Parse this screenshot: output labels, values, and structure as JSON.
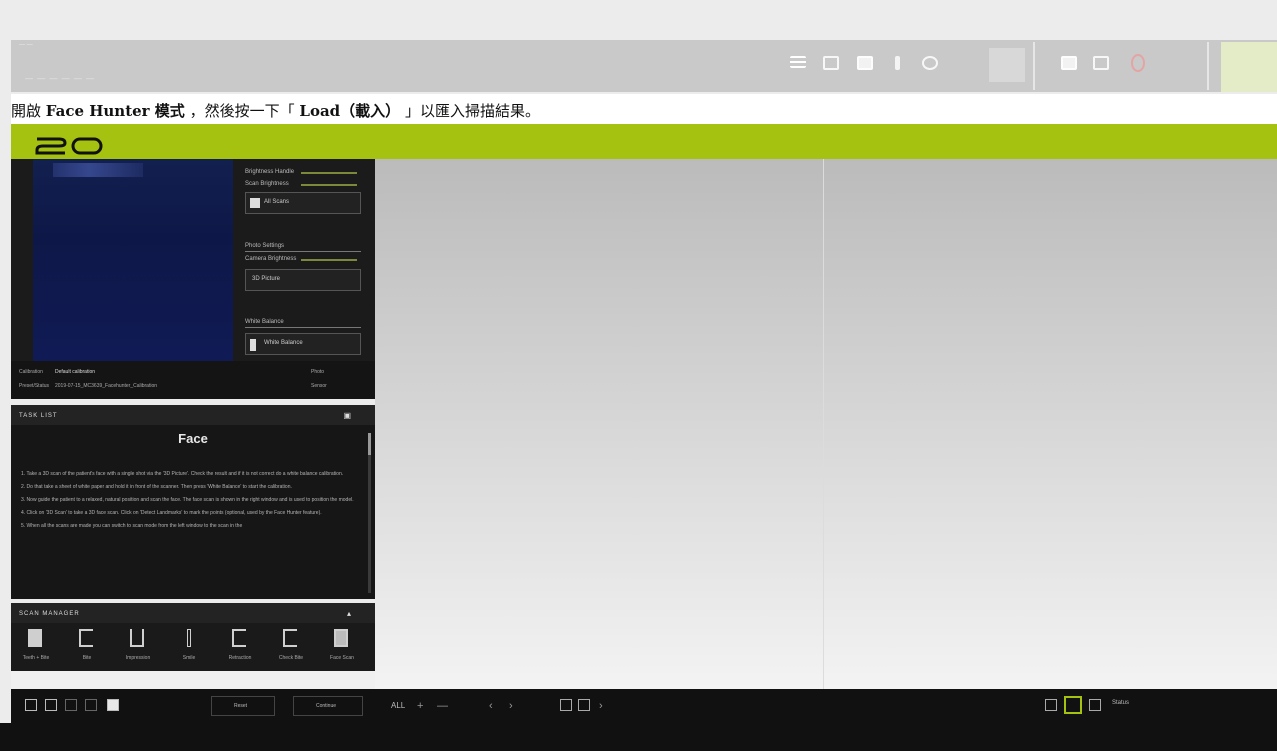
{
  "caption": {
    "prefix": "開啟 ",
    "mode_name": "Face Hunter 模式",
    "middle": "，然後按一下「",
    "button_name": "Load（載入）",
    "suffix": "」以匯入掃描結果。"
  },
  "window": {
    "tiny_label": "— —",
    "title_blur": "— — — — — —"
  },
  "settings": {
    "brightness_label": "Brightness Handle",
    "scan_brightness_label": "Scan Brightness",
    "all_scans_label": "All Scans",
    "photo_settings_label": "Photo Settings",
    "camera_brightness_label": "Camera Brightness",
    "photo_button": "3D Picture",
    "white_balance_label": "White Balance",
    "white_balance_button": "White Balance"
  },
  "calibration": {
    "label": "Calibration",
    "value": "Default calibration",
    "preset_label": "Preset/Status",
    "preset_value": "2019-07-15_MC3639_Facehunter_Calibration",
    "right1": "Photo",
    "right2": "Sensor"
  },
  "task_list": {
    "header": "TASK LIST",
    "title": "Face",
    "paragraphs": [
      "1. Take a 3D scan of the patient's face with a single shot via the '3D Picture'. Check the result and if it is not correct do a white balance calibration.",
      "2. Do that take a sheet of white paper and hold it in front of the scanner. Then press 'White Balance' to start the calibration.",
      "3. Now guide the patient to a relaxed, natural position and scan the face. The face scan is shown in the right window and is used to position the model.",
      "4. Click on '3D Scan' to take a 3D face scan. Click on 'Detect Landmarks' to mark the points (optional, used by the Face Hunter feature).",
      "5. When all the scans are made you can switch to scan mode from the left window to the scan in the"
    ]
  },
  "scan_manager": {
    "header": "SCAN MANAGER",
    "items": [
      "Teeth + Bite",
      "Bite",
      "Impression",
      "Smile",
      "Retraction",
      "Check Bite",
      "Face Scan"
    ]
  },
  "bottom_left": {
    "reset_label": "Reset",
    "continue_label": "Continue"
  },
  "bottom_right": {
    "all_label": "ALL",
    "plus": "+",
    "minus": "—",
    "prev": "‹",
    "next": "›",
    "forward": "›",
    "status_label": "Status"
  }
}
